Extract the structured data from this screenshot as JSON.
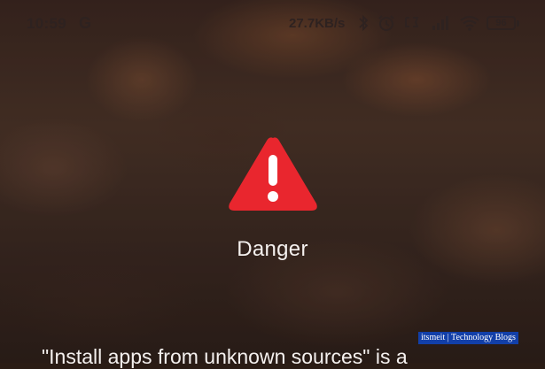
{
  "status_bar": {
    "time": "10:59",
    "carrier_icon": "G",
    "net_speed": "27.7KB/s",
    "icons": [
      "bluetooth-icon",
      "alarm-icon",
      "dual-sim-icon",
      "signal-icon",
      "wifi-icon"
    ],
    "battery_level": "96"
  },
  "dialog": {
    "icon": "warning-triangle-icon",
    "title": "Danger",
    "message": "\"Install apps from unknown sources\" is a"
  },
  "watermark": "itsmeit | Technology Blogs",
  "colors": {
    "warning_red": "#e9262e",
    "text": "#f4f0ee",
    "watermark_bg": "#123fa8"
  }
}
